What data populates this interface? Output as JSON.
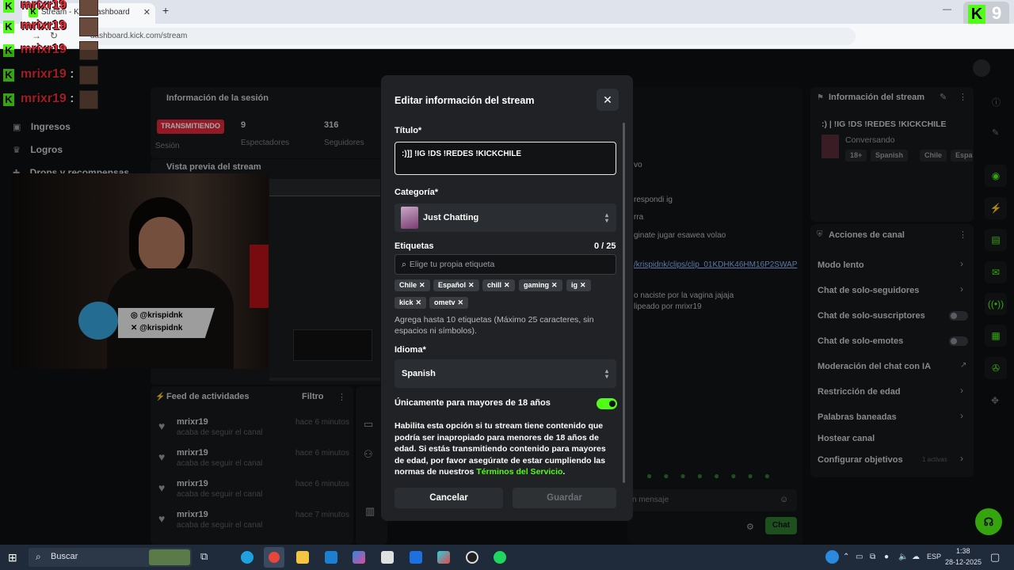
{
  "browser": {
    "tab_title": "Stream - Kick Dashboard",
    "tab_close": "✕",
    "new_tab": "+",
    "url": "dashboard.kick.com/stream",
    "window_badge": "9"
  },
  "overlay_chat": [
    {
      "user": "mrixr19",
      "suffix": ""
    },
    {
      "user": "mrixr19",
      "suffix": ":"
    },
    {
      "user": "mrixr19",
      "suffix": ":"
    },
    {
      "user": "mrixr19",
      "suffix": ":"
    },
    {
      "user": "mrixr19",
      "suffix": ":"
    }
  ],
  "sidebar": {
    "items": [
      {
        "label": "Ingresos"
      },
      {
        "label": "Logros"
      },
      {
        "label": "Drops y recompensas"
      }
    ]
  },
  "session": {
    "title": "Información de la sesión",
    "live_badge": "TRANSMITIENDO",
    "session_label": "Sesión",
    "viewers_value": "9",
    "viewers_label": "Espectadores",
    "followers_value": "316",
    "followers_label": "Seguidores",
    "preview_title": "Vista previa del stream"
  },
  "webcam": {
    "handle_ig": "@krispidnk",
    "handle_x": "@krispidnk"
  },
  "activity": {
    "title": "Feed de actividades",
    "filter": "Filtro",
    "items": [
      {
        "user": "mrixr19",
        "action": "acaba de seguir el canal",
        "time": "hace 6 minutos"
      },
      {
        "user": "mrixr19",
        "action": "acaba de seguir el canal",
        "time": "hace 6 minutos"
      },
      {
        "user": "mrixr19",
        "action": "acaba de seguir el canal",
        "time": "hace 6 minutos"
      },
      {
        "user": "mrixr19",
        "action": "acaba de seguir el canal",
        "time": "hace 7 minutos"
      }
    ]
  },
  "chat_fragments": [
    "vo",
    "respondi ig",
    "rra",
    "ginate jugar esawea volao",
    "/krispidnk/clips/clip_01KDHK46HM16P2SWAP",
    "o naciste por la vagina jajaja",
    "lipeado por mrixr19"
  ],
  "chat_input_placeholder": "n mensaje",
  "chat_send": "Chat",
  "stream_info": {
    "title": "Información del stream",
    "stream_title": ":) | !IG !DS !REDES !KICKCHILE",
    "category": "Conversando",
    "tags": [
      "18+",
      "Spanish",
      "Chile",
      "Españ"
    ]
  },
  "channel_actions": {
    "title": "Acciones de canal",
    "items": [
      {
        "label": "Modo lento",
        "control": "chevron"
      },
      {
        "label": "Chat de solo-seguidores",
        "control": "chevron"
      },
      {
        "label": "Chat de solo-suscriptores",
        "control": "toggle"
      },
      {
        "label": "Chat de solo-emotes",
        "control": "toggle"
      },
      {
        "label": "Moderación del chat con IA",
        "control": "external"
      },
      {
        "label": "Restricción de edad",
        "control": "chevron"
      },
      {
        "label": "Palabras baneadas",
        "control": "chevron"
      },
      {
        "label": "Hostear canal",
        "control": "none"
      },
      {
        "label": "Configurar objetivos",
        "control": "chevron"
      }
    ],
    "goals_badge": "1 activas"
  },
  "modal": {
    "title": "Editar información del stream",
    "close": "✕",
    "title_label": "Título*",
    "title_value": ":)]] !IG !DS !REDES !KICKCHILE",
    "category_label": "Categoría*",
    "category_value": "Just Chatting",
    "tags_label": "Etiquetas",
    "tags_count": "0 / 25",
    "tags_placeholder": "Elige tu propia etiqueta",
    "tags": [
      "Chile",
      "Español",
      "chill",
      "gaming",
      "ig",
      "kick",
      "ometv"
    ],
    "tags_hint": "Agrega hasta 10 etiquetas (Máximo 25 caracteres, sin espacios ni símbolos).",
    "language_label": "Idioma*",
    "language_value": "Spanish",
    "mature_label": "Únicamente para mayores de 18 años",
    "mature_on": true,
    "mature_text": "Habilita esta opción si tu stream tiene contenido que podría ser inapropiado para menores de 18 años de edad. Si estás transmitiendo contenido para mayores de edad, por favor asegúrate de estar cumpliendo las normas de nuestros",
    "mature_link": "Términos del Servicio",
    "mature_end": ".",
    "cancel": "Cancelar",
    "save": "Guardar"
  },
  "taskbar": {
    "search_placeholder": "Buscar",
    "language": "ESP",
    "time": "1:38",
    "date": "28-12-2025"
  },
  "colors": {
    "kick_green": "#53fc18",
    "live_red": "#e0283b",
    "overlay_name": "#ff2a3b"
  }
}
